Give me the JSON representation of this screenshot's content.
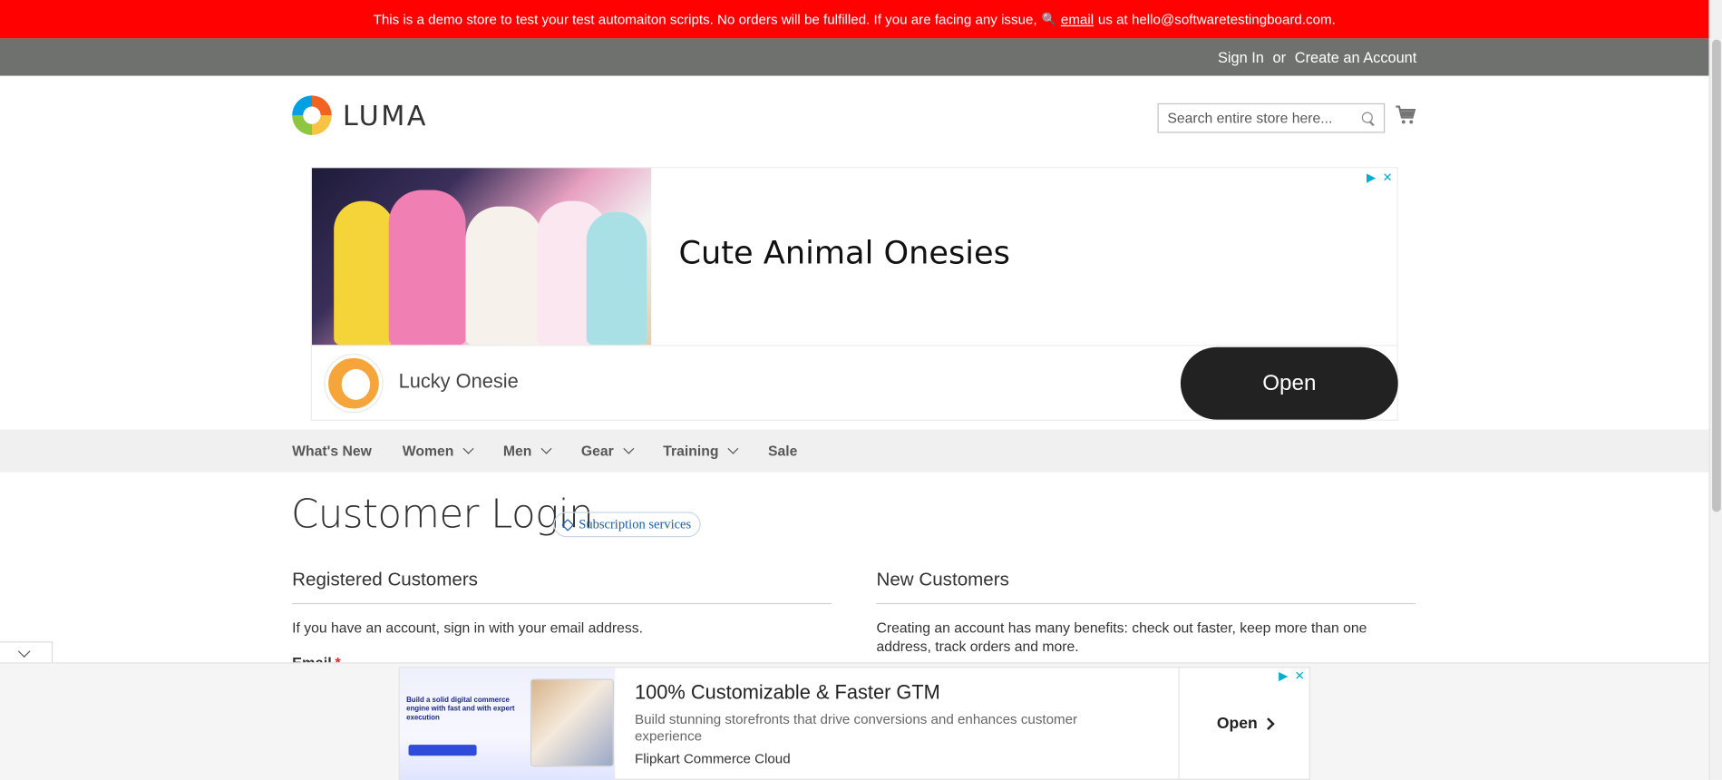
{
  "notice": {
    "text_before": "This is a demo store to test your test automaiton scripts. No orders will be fulfilled. If you are facing any issue,",
    "link": "email",
    "text_after": "us at hello@softwaretestingboard.com.",
    "color": "#ff0101"
  },
  "header": {
    "sign_in": "Sign In",
    "or": "or",
    "create_account": "Create an Account",
    "logo_text": "LUMA",
    "search_placeholder": "Search entire store here..."
  },
  "top_ad": {
    "headline": "Cute Animal Onesies",
    "app_name": "Lucky Onesie",
    "cta": "Open",
    "adchoices_icon": "play-triangle-icon",
    "close_icon": "close-icon"
  },
  "nav": {
    "items": [
      {
        "label": "What's New",
        "has_dropdown": false
      },
      {
        "label": "Women",
        "has_dropdown": true
      },
      {
        "label": "Men",
        "has_dropdown": true
      },
      {
        "label": "Gear",
        "has_dropdown": true
      },
      {
        "label": "Training",
        "has_dropdown": true
      },
      {
        "label": "Sale",
        "has_dropdown": false
      }
    ]
  },
  "page": {
    "title": "Customer Login",
    "badge": "Subscription services",
    "registered": {
      "title": "Registered Customers",
      "text": "If you have an account, sign in with your email address.",
      "email_label": "Email",
      "required_mark": "*"
    },
    "new_customers": {
      "title": "New Customers",
      "text": "Creating an account has many benefits: check out faster, keep more than one address, track orders and more."
    }
  },
  "bottom_ad": {
    "thumb_text": "Build a solid digital commerce engine with fast and with expert execution",
    "headline": "100% Customizable & Faster GTM",
    "description": "Build stunning storefronts that drive conversions and enhances customer experience",
    "advertiser": "Flipkart Commerce Cloud",
    "cta": "Open"
  }
}
